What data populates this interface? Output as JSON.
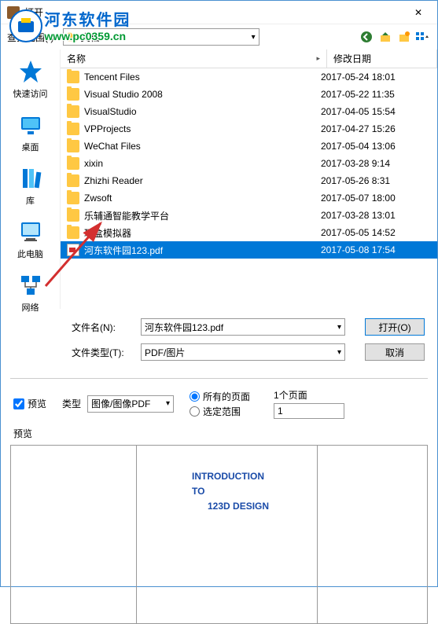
{
  "window": {
    "title": "打开",
    "close_glyph": "✕"
  },
  "watermark": {
    "cn": "河东软件园",
    "url": "www.pc0359.cn"
  },
  "toolbar": {
    "scope_label": "查找范围(I):",
    "scope_value": "文档"
  },
  "sidebar": {
    "items": [
      {
        "name": "quick-access",
        "label": "快速访问"
      },
      {
        "name": "desktop",
        "label": "桌面"
      },
      {
        "name": "libraries",
        "label": "库"
      },
      {
        "name": "this-pc",
        "label": "此电脑"
      },
      {
        "name": "network",
        "label": "网络"
      }
    ]
  },
  "columns": {
    "name": "名称",
    "date": "修改日期"
  },
  "files": [
    {
      "type": "folder",
      "name": "Tencent Files",
      "date": "2017-05-24 18:01"
    },
    {
      "type": "folder",
      "name": "Visual Studio 2008",
      "date": "2017-05-22 11:35"
    },
    {
      "type": "folder",
      "name": "VisualStudio",
      "date": "2017-04-05 15:54"
    },
    {
      "type": "folder",
      "name": "VPProjects",
      "date": "2017-04-27 15:26"
    },
    {
      "type": "folder",
      "name": "WeChat Files",
      "date": "2017-05-04 13:06"
    },
    {
      "type": "folder",
      "name": "xixin",
      "date": "2017-03-28 9:14"
    },
    {
      "type": "folder",
      "name": "Zhizhi Reader",
      "date": "2017-05-26 8:31"
    },
    {
      "type": "folder",
      "name": "Zwsoft",
      "date": "2017-05-07 18:00"
    },
    {
      "type": "folder",
      "name": "乐辅通智能教学平台",
      "date": "2017-03-28 13:01"
    },
    {
      "type": "folder",
      "name": "玩盒模拟器",
      "date": "2017-05-05 14:52"
    },
    {
      "type": "pdf",
      "name": "河东软件园123.pdf",
      "date": "2017-05-08 17:54",
      "selected": true
    }
  ],
  "inputs": {
    "filename_label": "文件名(N):",
    "filename_value": "河东软件园123.pdf",
    "filetype_label": "文件类型(T):",
    "filetype_value": "PDF/图片",
    "open_button": "打开(O)",
    "cancel_button": "取消"
  },
  "preview": {
    "checkbox_label": "预览",
    "type_label": "类型",
    "type_value": "图像/图像PDF",
    "radio_all": "所有的页面",
    "radio_range": "选定范围",
    "page_count_label": "1个页面",
    "page_value": "1",
    "section_label": "预览",
    "pdf_line1": "INTRODUCTION",
    "pdf_line2": "TO",
    "pdf_line3": "123D DESIGN"
  }
}
